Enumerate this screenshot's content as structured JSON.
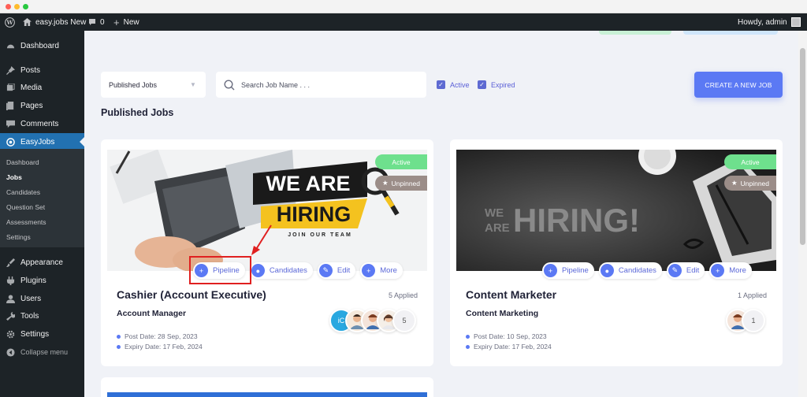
{
  "adminbar": {
    "site_name": "easy.jobs New",
    "comments_count": "0",
    "new_label": "New",
    "greeting": "Howdy, admin"
  },
  "sidebar": {
    "items": [
      {
        "label": "Dashboard",
        "icon": "dashboard-icon"
      },
      {
        "label": "Posts",
        "icon": "pin-icon"
      },
      {
        "label": "Media",
        "icon": "media-icon"
      },
      {
        "label": "Pages",
        "icon": "pages-icon"
      },
      {
        "label": "Comments",
        "icon": "comments-icon"
      },
      {
        "label": "EasyJobs",
        "icon": "easyjobs-icon"
      },
      {
        "label": "Appearance",
        "icon": "appearance-icon"
      },
      {
        "label": "Plugins",
        "icon": "plugins-icon"
      },
      {
        "label": "Users",
        "icon": "users-icon"
      },
      {
        "label": "Tools",
        "icon": "tools-icon"
      },
      {
        "label": "Settings",
        "icon": "settings-icon"
      },
      {
        "label": "Collapse menu",
        "icon": "collapse-icon"
      }
    ],
    "submenu": [
      "Dashboard",
      "Jobs",
      "Candidates",
      "Question Set",
      "Assessments",
      "Settings"
    ]
  },
  "filters": {
    "status_select": "Published Jobs",
    "search_placeholder": "Search Job Name . . .",
    "active_label": "Active",
    "expired_label": "Expired",
    "create_button": "CREATE A NEW JOB"
  },
  "section_title": "Published Jobs",
  "banners": {
    "left_line1": "WE ARE",
    "left_line2": "HIRING",
    "left_line3": "JOIN OUR TEAM",
    "right_we": "WE",
    "right_are": "ARE",
    "right_hiring": "HIRING!"
  },
  "jobs": [
    {
      "status": "Active",
      "pin": "Unpinned",
      "actions": [
        "Pipeline",
        "Candidates",
        "Edit",
        "More"
      ],
      "title": "Cashier (Account Executive)",
      "applied": "5 Applied",
      "subtitle": "Account Manager",
      "post_date": "Post Date: 28 Sep, 2023",
      "expiry_date": "Expiry Date: 17 Feb, 2024",
      "avatar_count": "5"
    },
    {
      "status": "Active",
      "pin": "Unpinned",
      "actions": [
        "Pipeline",
        "Candidates",
        "Edit",
        "More"
      ],
      "title": "Content Marketer",
      "applied": "1 Applied",
      "subtitle": "Content Marketing",
      "post_date": "Post Date: 10 Sep, 2023",
      "expiry_date": "Expiry Date: 17 Feb, 2024",
      "avatar_count": "1"
    }
  ],
  "colors": {
    "admin_dark": "#1d2327",
    "wp_blue": "#2271b1",
    "accent": "#5b79f4",
    "active_green": "#6ee08d",
    "highlight_red": "#e02020"
  }
}
